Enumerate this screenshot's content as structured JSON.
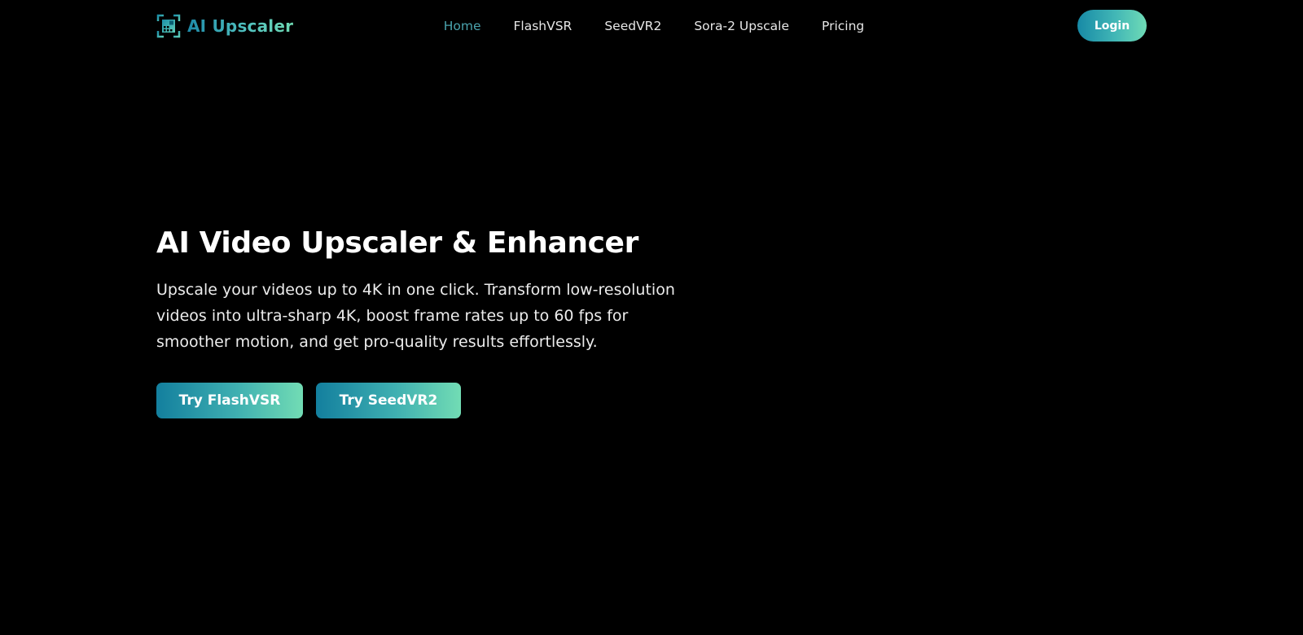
{
  "brand": {
    "name": "AI Upscaler",
    "icon": "upscale-frame-icon"
  },
  "nav": {
    "items": [
      {
        "label": "Home",
        "active": true
      },
      {
        "label": "FlashVSR",
        "active": false
      },
      {
        "label": "SeedVR2",
        "active": false
      },
      {
        "label": "Sora-2 Upscale",
        "active": false
      },
      {
        "label": "Pricing",
        "active": false
      }
    ]
  },
  "header": {
    "login_label": "Login"
  },
  "hero": {
    "title": "AI Video Upscaler & Enhancer",
    "description": "Upscale your videos up to 4K in one click. Transform low-resolution videos into ultra-sharp 4K, boost frame rates up to 60 fps for smoother motion, and get pro-quality results effortlessly.",
    "cta_primary": "Try FlashVSR",
    "cta_secondary": "Try SeedVR2"
  },
  "colors": {
    "background": "#000000",
    "accent_start": "#178aa6",
    "accent_end": "#6fdbb6",
    "nav_active": "#4aa3ad",
    "text": "#ffffff"
  }
}
